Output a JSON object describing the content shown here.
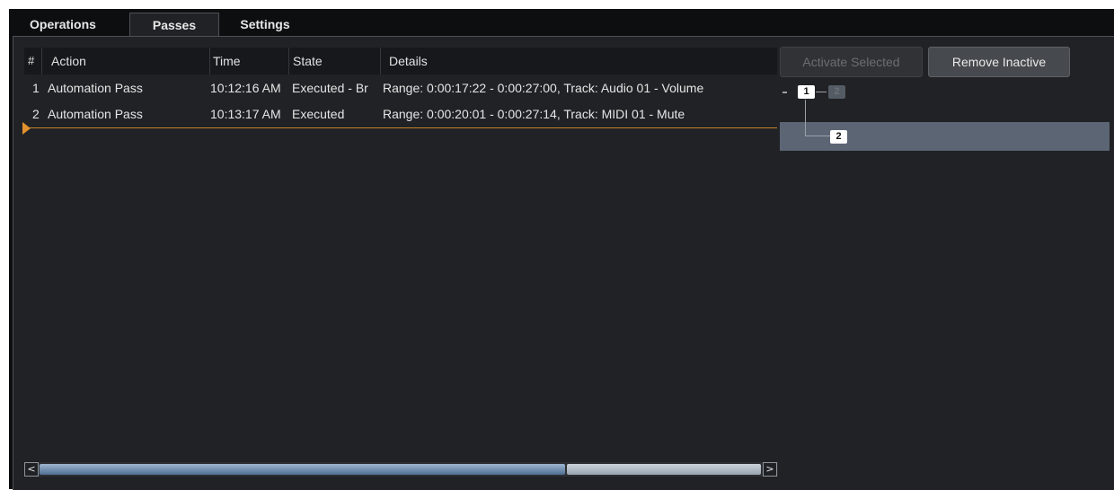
{
  "tabs": [
    {
      "label": "Operations"
    },
    {
      "label": "Passes"
    },
    {
      "label": "Settings"
    }
  ],
  "columns": [
    "#",
    "Action",
    "Time",
    "State",
    "Details"
  ],
  "rows": [
    {
      "num": "1",
      "action": "Automation Pass",
      "time": "10:12:16 AM",
      "state": "Executed - Br",
      "details": "Range: 0:00:17:22 - 0:00:27:00, Track: Audio 01 - Volume"
    },
    {
      "num": "2",
      "action": "Automation Pass",
      "time": "10:13:17 AM",
      "state": "Executed",
      "details": "Range: 0:00:20:01 - 0:00:27:14, Track: MIDI 01 - Mute"
    }
  ],
  "buttons": {
    "activate_selected": "Activate Selected",
    "remove_inactive": "Remove Inactive"
  },
  "tree": {
    "dash": "-",
    "node1": "1",
    "node2_inactive": "2",
    "node2_selected": "2"
  },
  "scroll": {
    "left": "<",
    "right": ">"
  },
  "colors": {
    "accent_marker": "#e1922e",
    "selection": "#5c6574",
    "panel_bg": "#202225"
  }
}
